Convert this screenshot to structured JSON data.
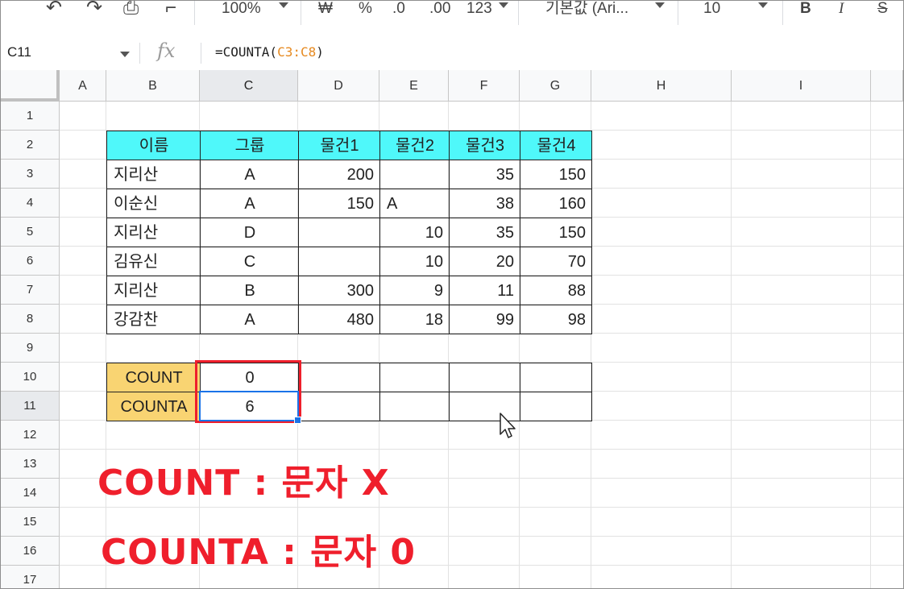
{
  "toolbar": {
    "zoom": "100%",
    "currency": "₩",
    "percent": "%",
    "decrease_decimal": ".0",
    "increase_decimal": ".00",
    "more_formats": "123",
    "font": "기본값 (Ari...",
    "font_size": "10",
    "bold": "B",
    "italic": "I",
    "strike": "S"
  },
  "formula_bar": {
    "cell_ref": "C11",
    "fx": "fx",
    "formula_prefix": "=COUNTA(",
    "formula_range": "C3:C8",
    "formula_suffix": ")"
  },
  "columns": [
    "A",
    "B",
    "C",
    "D",
    "E",
    "F",
    "G",
    "H",
    "I"
  ],
  "rows": [
    "1",
    "2",
    "3",
    "4",
    "5",
    "6",
    "7",
    "8",
    "9",
    "10",
    "11",
    "12",
    "13",
    "14",
    "15",
    "16",
    "17"
  ],
  "table": {
    "headers": [
      "이름",
      "그룹",
      "물건1",
      "물건2",
      "물건3",
      "물건4"
    ],
    "rows": [
      [
        "지리산",
        "A",
        "200",
        "",
        "35",
        "150"
      ],
      [
        "이순신",
        "A",
        "150",
        "A",
        "38",
        "160"
      ],
      [
        "지리산",
        "D",
        "",
        "10",
        "35",
        "150"
      ],
      [
        "김유신",
        "C",
        "",
        "10",
        "20",
        "70"
      ],
      [
        "지리산",
        "B",
        "300",
        "9",
        "11",
        "88"
      ],
      [
        "강감찬",
        "A",
        "480",
        "18",
        "99",
        "98"
      ]
    ]
  },
  "summary": [
    {
      "label": "COUNT",
      "value": "0"
    },
    {
      "label": "COUNTA",
      "value": "6"
    }
  ],
  "annotations": {
    "count_note": "COUNT : 문자 X",
    "counta_note": "COUNTA : 문자 0"
  },
  "colors": {
    "header_fill": "#4ff8fa",
    "label_fill": "#f9d472",
    "highlight_red": "#ef1f2c",
    "selection_blue": "#1a73e8",
    "formula_range": "#e6891f"
  }
}
